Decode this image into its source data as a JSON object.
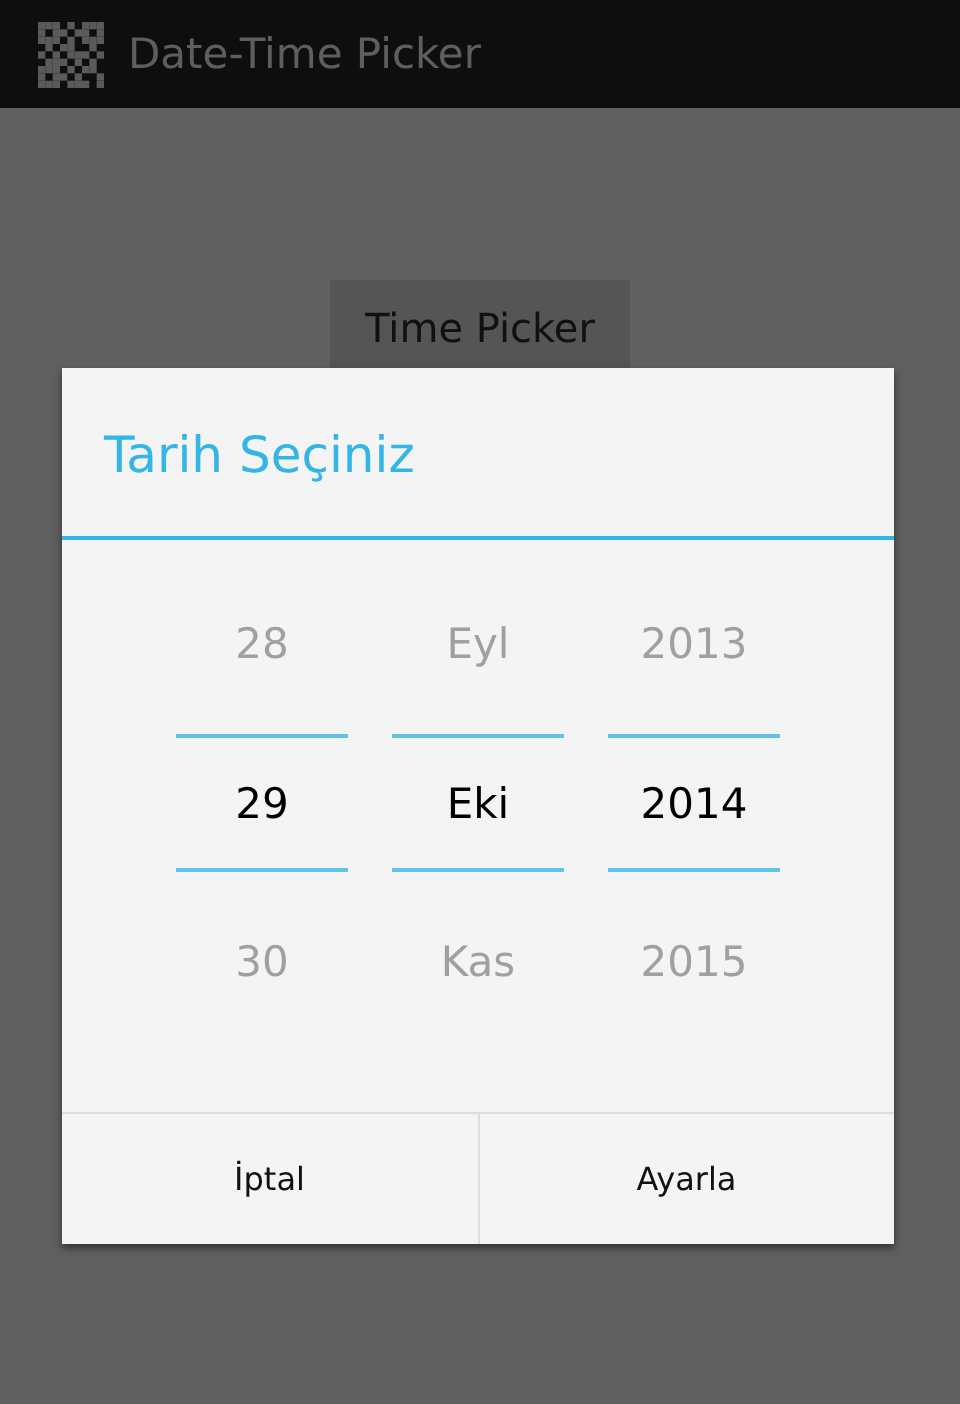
{
  "action_bar": {
    "title": "Date-Time Picker"
  },
  "background_button": {
    "label": "Time Picker"
  },
  "dialog": {
    "title": "Tarih Seçiniz",
    "pickers": [
      {
        "items": [
          {
            "text": "28",
            "selected": false
          },
          {
            "text": "29",
            "selected": true
          },
          {
            "text": "30",
            "selected": false
          }
        ]
      },
      {
        "items": [
          {
            "text": "Eyl",
            "selected": false
          },
          {
            "text": "Eki",
            "selected": true
          },
          {
            "text": "Kas",
            "selected": false
          }
        ]
      },
      {
        "items": [
          {
            "text": "2013",
            "selected": false
          },
          {
            "text": "2014",
            "selected": true
          },
          {
            "text": "2015",
            "selected": false
          }
        ]
      }
    ],
    "buttons": [
      "İptal",
      "Ayarla"
    ]
  }
}
